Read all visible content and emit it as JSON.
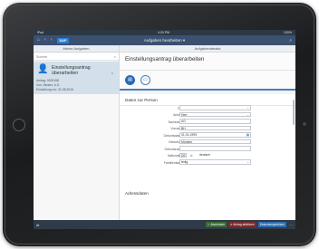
{
  "status_bar": {
    "left": "iPad",
    "time": "4:20 PM",
    "right": "100%"
  },
  "shell": {
    "title": "Aufgaben bearbeiten",
    "title_chevron": "▾",
    "logo": "SAP",
    "icons": [
      "home-icon",
      "back-icon",
      "forward-icon",
      "logo"
    ],
    "icon_glyphs": {
      "home": "⌂",
      "back": "‹",
      "forward": "›",
      "search": "⌕"
    }
  },
  "master": {
    "header": "Meine Aufgaben",
    "search_placeholder": "Suchen",
    "task": {
      "icon": "person-edit-icon",
      "title": "Einstellungsantrag überarbeiten",
      "id": "Antrag: 0000158",
      "requester": "Von: Muster, A.G.",
      "created": "Einstellung vor: 31.08.2016"
    }
  },
  "detail": {
    "header": "Aufgabendetails",
    "object_title": "Einstellungsantrag überarbeiten",
    "tabs": [
      {
        "icon": "form-icon",
        "active": true
      },
      {
        "icon": "comments-icon",
        "active": false
      }
    ],
    "section_title": "Daten zur Person",
    "fields": [
      {
        "label": "Titel",
        "value": "",
        "dropdown": true
      },
      {
        "label": "Anrede",
        "value": "Herr",
        "dropdown": true
      },
      {
        "label": "Nachname",
        "value": "AG"
      },
      {
        "label": "Vorname",
        "value": "BH"
      },
      {
        "label": "Geburtsdatum",
        "value": "01.01.1999",
        "calendar": true
      },
      {
        "label": "Geburtsort",
        "value": "Münster"
      },
      {
        "label": "Geburtsname",
        "value": ""
      },
      {
        "label": "Nationalität",
        "code": "DE",
        "text": "deutsch"
      },
      {
        "label": "Familienstand",
        "value": "ledig",
        "dropdown": true
      }
    ],
    "section2_title": "Adressdaten"
  },
  "footer": {
    "left": "⇄",
    "accept": "✓ Annehmen",
    "reject": "✕ Antrag ablehnen",
    "save": "Zwischenspeichern",
    "more": "⋯"
  },
  "colors": {
    "shell": "#3a5170",
    "accent": "#2b6cb3",
    "task_selected": "#d3e0ec",
    "footer": "#2f3b48"
  }
}
